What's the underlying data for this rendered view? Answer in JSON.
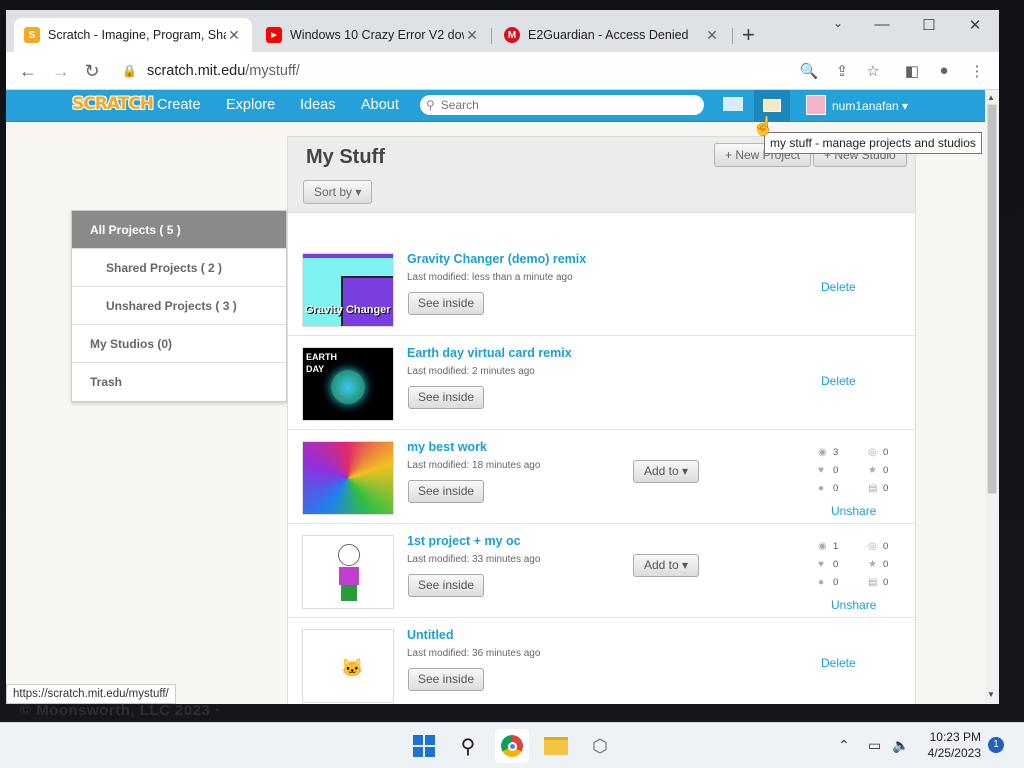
{
  "browser": {
    "tabs": [
      {
        "title": "Scratch - Imagine, Program, Shar",
        "favicon": "scratch-icon",
        "active": true
      },
      {
        "title": "Windows 10 Crazy Error V2 dow",
        "favicon": "youtube-icon"
      },
      {
        "title": "E2Guardian - Access Denied",
        "favicon": "e2guardian-icon"
      }
    ],
    "url_host": "scratch.mit.edu",
    "url_path": "/mystuff/",
    "status_url": "https://scratch.mit.edu/mystuff/"
  },
  "scratch_nav": {
    "logo": "SCRATCH",
    "links": [
      "Create",
      "Explore",
      "Ideas",
      "About"
    ],
    "search_placeholder": "Search",
    "username": "num1anafan ▾",
    "tooltip": "my stuff - manage projects and studios"
  },
  "sidebar": {
    "items": [
      {
        "label": "All Projects ( 5 )"
      },
      {
        "label": "Shared Projects ( 2 )"
      },
      {
        "label": "Unshared Projects ( 3 )"
      },
      {
        "label": "My Studios (0)"
      },
      {
        "label": "Trash"
      }
    ]
  },
  "main": {
    "title": "My Stuff",
    "new_project": "+ New Project",
    "new_studio": "+ New Studio",
    "sort_by": "Sort by ▾",
    "see_inside": "See inside",
    "add_to": "Add to ▾",
    "delete": "Delete",
    "unshare": "Unshare",
    "projects": [
      {
        "title": "Gravity Changer (demo) remix",
        "modified": "Last modified: less than a minute ago",
        "thumb_text": "Gravity Changer"
      },
      {
        "title": "Earth day virtual card remix",
        "modified": "Last modified: 2 minutes ago",
        "thumb_text": "EARTH DAY"
      },
      {
        "title": "my best work",
        "modified": "Last modified: 18 minutes ago",
        "stats": {
          "views": "3",
          "remixes": "0",
          "loves": "0",
          "favorites": "0",
          "comments": "0",
          "studios": "0"
        }
      },
      {
        "title": "1st project + my oc",
        "modified": "Last modified: 33 minutes ago",
        "stats": {
          "views": "1",
          "remixes": "0",
          "loves": "0",
          "favorites": "0",
          "comments": "0",
          "studios": "0"
        }
      },
      {
        "title": "Untitled",
        "modified": "Last modified: 36 minutes ago"
      }
    ]
  },
  "desktop": {
    "footer": "© Moonsworth, LLC 2023 ·"
  },
  "taskbar": {
    "time": "10:23 PM",
    "date": "4/25/2023",
    "notifications": "1"
  }
}
